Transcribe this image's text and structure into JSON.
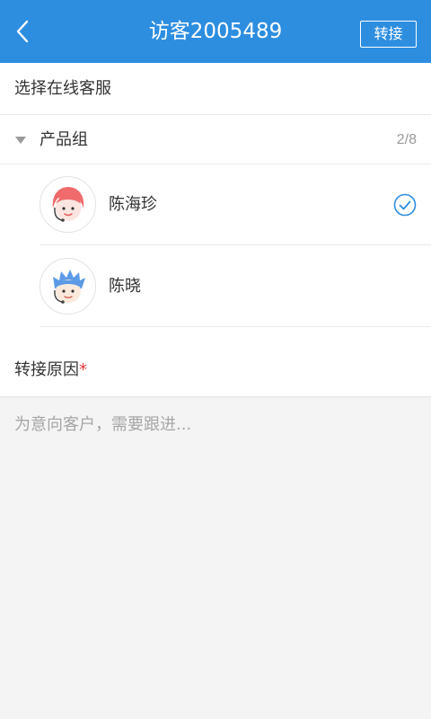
{
  "header": {
    "title": "访客2005489",
    "transfer_label": "转接",
    "color": "#2d8ee0"
  },
  "select_section": {
    "label": "选择在线客服"
  },
  "group": {
    "name": "产品组",
    "count": "2/8",
    "expanded": true
  },
  "agents": [
    {
      "name": "陈海珍",
      "avatar_icon": "female-agent-avatar-icon",
      "avatar_color": "#f06b6b",
      "selected": true
    },
    {
      "name": "陈晓",
      "avatar_icon": "male-agent-avatar-icon",
      "avatar_color": "#5b9ae6",
      "selected": false
    }
  ],
  "reason": {
    "label": "转接原因",
    "required_mark": "*",
    "placeholder": "为意向客户，需要跟进..."
  }
}
